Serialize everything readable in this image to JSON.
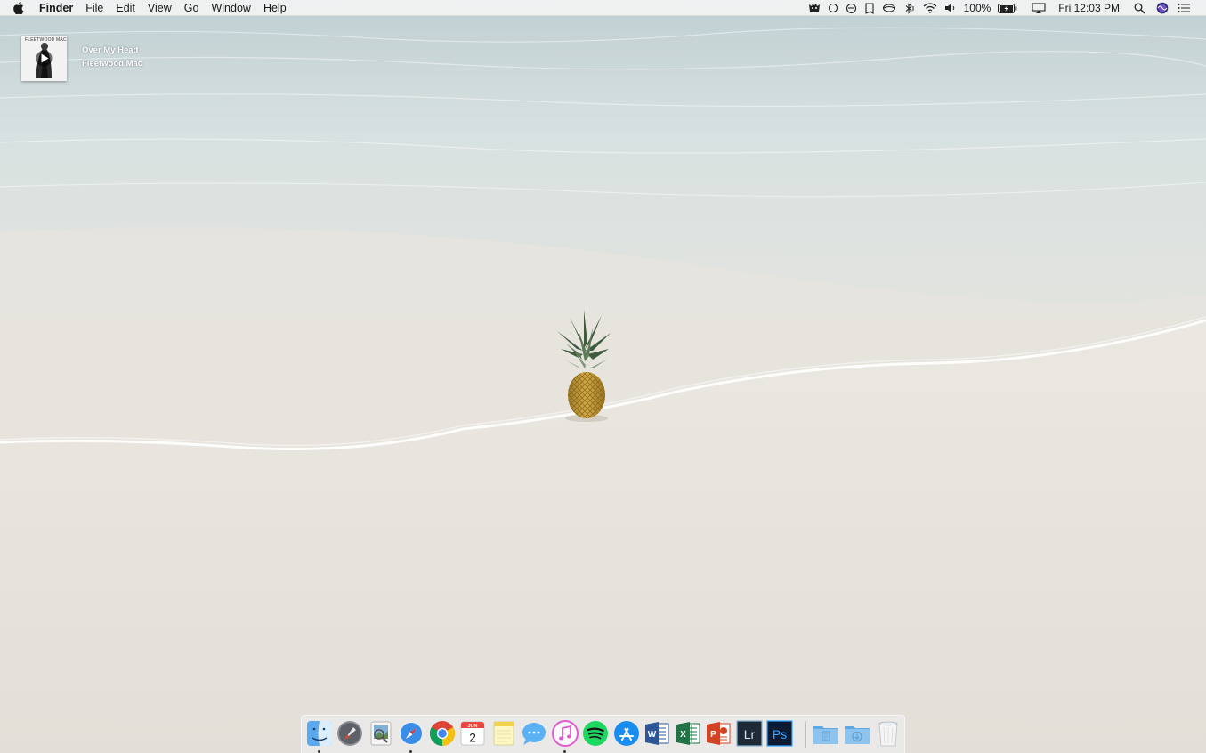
{
  "menubar": {
    "apple_icon": "apple-logo-icon",
    "app_name": "Finder",
    "menus": [
      "File",
      "Edit",
      "View",
      "Go",
      "Window",
      "Help"
    ],
    "status_icons": [
      "bat-icon",
      "circle-icon",
      "disc-icon",
      "bookmark-icon",
      "cloud-icon",
      "bluetooth-icon",
      "wifi-icon",
      "volume-icon"
    ],
    "battery_percent": "100%",
    "clock": "Fri 12:03 PM"
  },
  "now_playing": {
    "album_band_text": "FLEETWOOD MAC",
    "track": "Over My Head",
    "artist": "Fleetwood Mac"
  },
  "dock": {
    "calendar_month": "JUN",
    "calendar_day": "2",
    "word_letter": "W",
    "excel_letter": "X",
    "powerpoint_letter": "P",
    "lightroom_label": "Lr",
    "photoshop_label": "Ps",
    "items": [
      "Finder",
      "Launchpad",
      "Preview",
      "Safari",
      "Google Chrome",
      "Calendar",
      "Notes",
      "Messages",
      "iTunes",
      "Spotify",
      "App Store",
      "Microsoft Word",
      "Microsoft Excel",
      "Microsoft PowerPoint",
      "Adobe Lightroom",
      "Adobe Photoshop",
      "Documents",
      "Downloads",
      "Trash"
    ]
  },
  "colors": {
    "menubar_bg": "#f3f3f3",
    "sand": "#e6e2db",
    "water": "#cfdbdb"
  }
}
